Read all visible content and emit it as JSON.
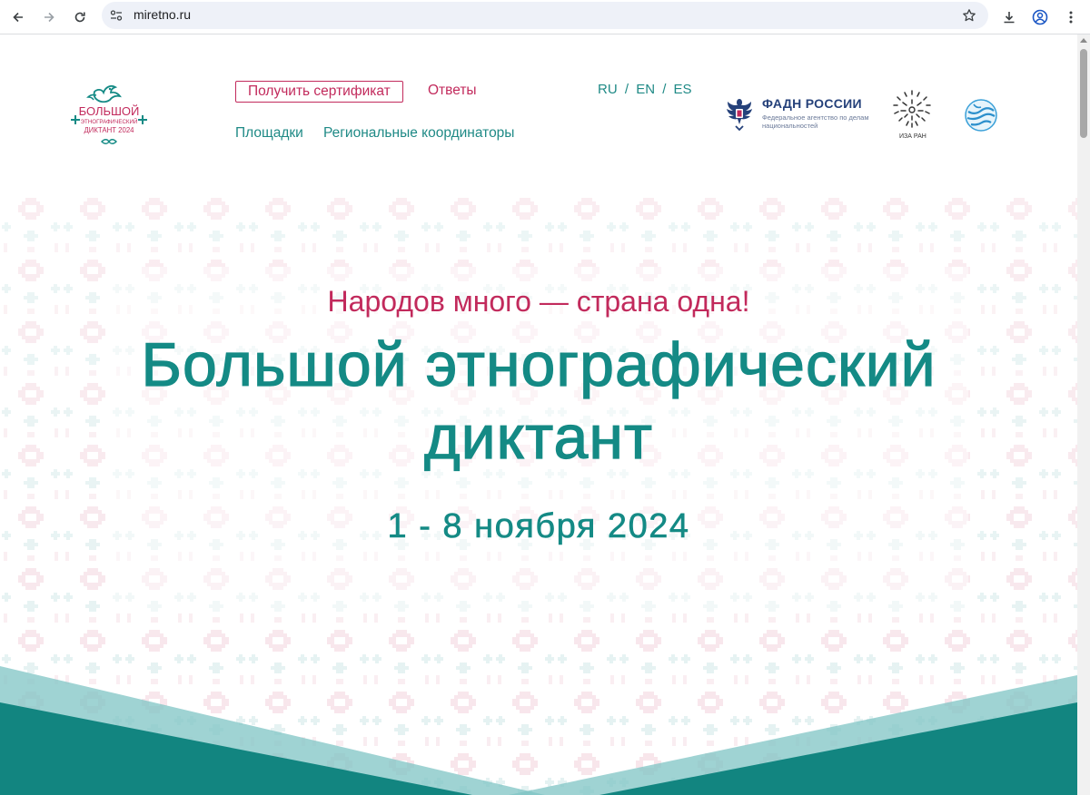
{
  "browser": {
    "url": "miretno.ru"
  },
  "header": {
    "logo": {
      "line1": "БОЛЬШОЙ",
      "line2": "ЭТНОГРАФИЧЕСКИЙ",
      "line3": "ДИКТАНТ 2024"
    },
    "certificate_button": "Получить сертификат",
    "answers_link": "Ответы",
    "venues_link": "Площадки",
    "coordinators_link": "Региональные координаторы",
    "languages": [
      "RU",
      "EN",
      "ES"
    ],
    "lang_separator": "/",
    "partners": {
      "fadn_title": "ФАДН РОССИИ",
      "fadn_subtitle": "Федеральное агентство по делам национальностей",
      "iza_label": "ИЗА РАН"
    }
  },
  "hero": {
    "slogan": "Народов много — страна одна!",
    "title_line1": "Большой этнографический",
    "title_line2": "диктант",
    "dates": "1 - 8 ноября 2024"
  },
  "colors": {
    "brand_teal": "#148a85",
    "brand_crimson": "#c22a5c",
    "fadn_blue": "#25417a"
  }
}
